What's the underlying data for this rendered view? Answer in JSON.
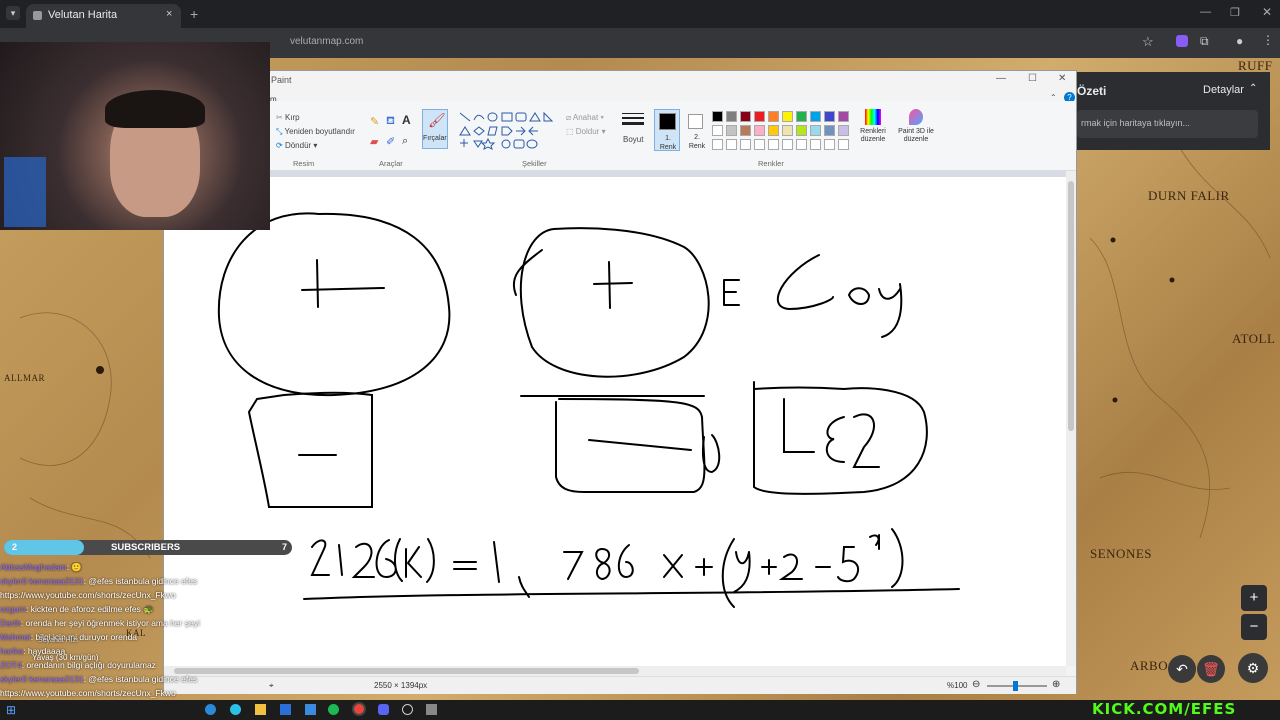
{
  "browser": {
    "tab_title": "Velutan Harita",
    "tab_close": "×",
    "new_tab": "+",
    "url": "velutanmap.com"
  },
  "map": {
    "labels": [
      "RUFF",
      "DURN FALIR",
      "ATOLL",
      "SENONES",
      "ARBO",
      "ALLMAR",
      "KAL"
    ],
    "zoom_in": "+",
    "zoom_out": "−"
  },
  "right_panel": {
    "title": "Özeti",
    "details": "Detaylar",
    "hint": "rmak için haritaya tıklayın..."
  },
  "paint": {
    "title": "Paint",
    "file_tab": "m",
    "image_group": {
      "crop": "Kırp",
      "resize": "Yeniden boyutlandır",
      "rotate": "Döndür",
      "label": "Resim"
    },
    "tools_group": {
      "label": "Araçlar"
    },
    "brushes": "Fırçalar",
    "shapes_group": {
      "outline": "Anahat",
      "fill": "Doldur",
      "label": "Şekiller"
    },
    "size": "Boyut",
    "color1": "1. Renk",
    "color2": "2. Renk",
    "colors_label": "Renkler",
    "edit_colors": "Renkleri düzenle",
    "paint3d": "Paint 3D ile düzenle",
    "dimensions": "2550 × 1394px",
    "zoom": "%100",
    "palette": [
      "#000000",
      "#7f7f7f",
      "#880015",
      "#ed1c24",
      "#ff7f27",
      "#fff200",
      "#22b14c",
      "#00a2e8",
      "#3f48cc",
      "#a349a4",
      "#ffffff",
      "#c3c3c3",
      "#b97a57",
      "#ffaec9",
      "#ffc90e",
      "#efe4b0",
      "#b5e61d",
      "#99d9ea",
      "#7092be",
      "#c8bfe7"
    ],
    "drawing": {
      "text_e_goy": "E Goy",
      "text_le2": "Le2",
      "equation": "2126+k)=1, 786 x+(y+2-5⁹)"
    }
  },
  "stream": {
    "subs_count": "2",
    "subs_label": "SUBSCRIBERS",
    "subs_goal": "7",
    "chat": [
      {
        "name": "AbbasMoghadam",
        "text": ": 🙂"
      },
      {
        "name": "skyler0 kenaraaa3131",
        "text": ": @efes istanbula gidince efes"
      },
      {
        "name": "",
        "text": "https://www.youtube.com/shorts/zecUnx_Fkwo"
      },
      {
        "name": "ozgurn",
        "text": ": kickten de aforoz edilme efes 🐢"
      },
      {
        "name": "Darth",
        "text": ": orenda her şeyi öğrenmek istiyor ama her şeyi"
      },
      {
        "name": "Mehmet",
        "text": ": bilgi için mi duruyor orenda"
      },
      {
        "name": "harika",
        "text": ": haydaaaa"
      },
      {
        "name": "ZOT4",
        "text": ": orendanın bilgi açlığı doyurulamaz"
      },
      {
        "name": "skyler0 kenaraaa3131",
        "text": ": @efes istanbula gidince efes"
      },
      {
        "name": "",
        "text": "https://www.youtube.com/shorts/zecUnx_Fkwo"
      }
    ],
    "overlay_speed_label": "Seyahat Hızı",
    "overlay_speed": "Yavaş (30 km/gün)",
    "kick_logo": "KICK.COM/EFES"
  },
  "colors": {
    "kick": "#53fc18",
    "paint_accent": "#0078d4"
  }
}
